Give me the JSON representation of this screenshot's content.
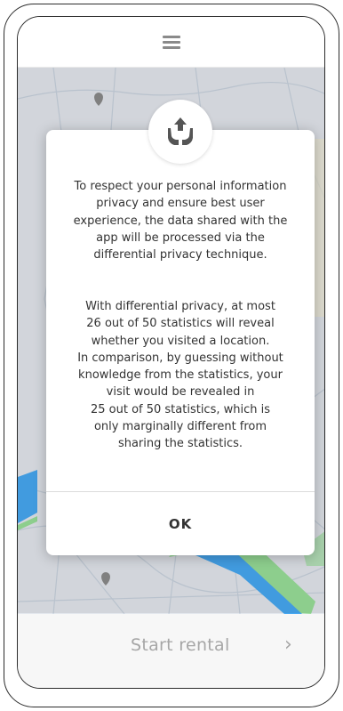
{
  "app": {
    "menu_icon": "hamburger-menu-icon"
  },
  "dialog": {
    "icon": "share-hands-icon",
    "paragraph1_lines": [
      "To respect your personal information",
      "privacy and ensure best user",
      "experience, the data shared with the",
      "app will be processed via the",
      "differential privacy technique."
    ],
    "paragraph2_lines": [
      "With differential privacy, at most",
      "26 out of 50 statistics will reveal",
      "whether you visited a location.",
      "In comparison, by guessing without",
      "knowledge from the statistics, your",
      "visit would be revealed in",
      "25 out of 50 statistics, which is",
      "only marginally different from",
      "sharing the statistics."
    ],
    "ok_label": "OK"
  },
  "bottom": {
    "start_rental_label": "Start rental",
    "chevron": "›"
  },
  "colors": {
    "water": "#47a9f2",
    "park": "#9ae09a",
    "map_bg": "#e4e8ee",
    "road": "#c5cfdc"
  }
}
